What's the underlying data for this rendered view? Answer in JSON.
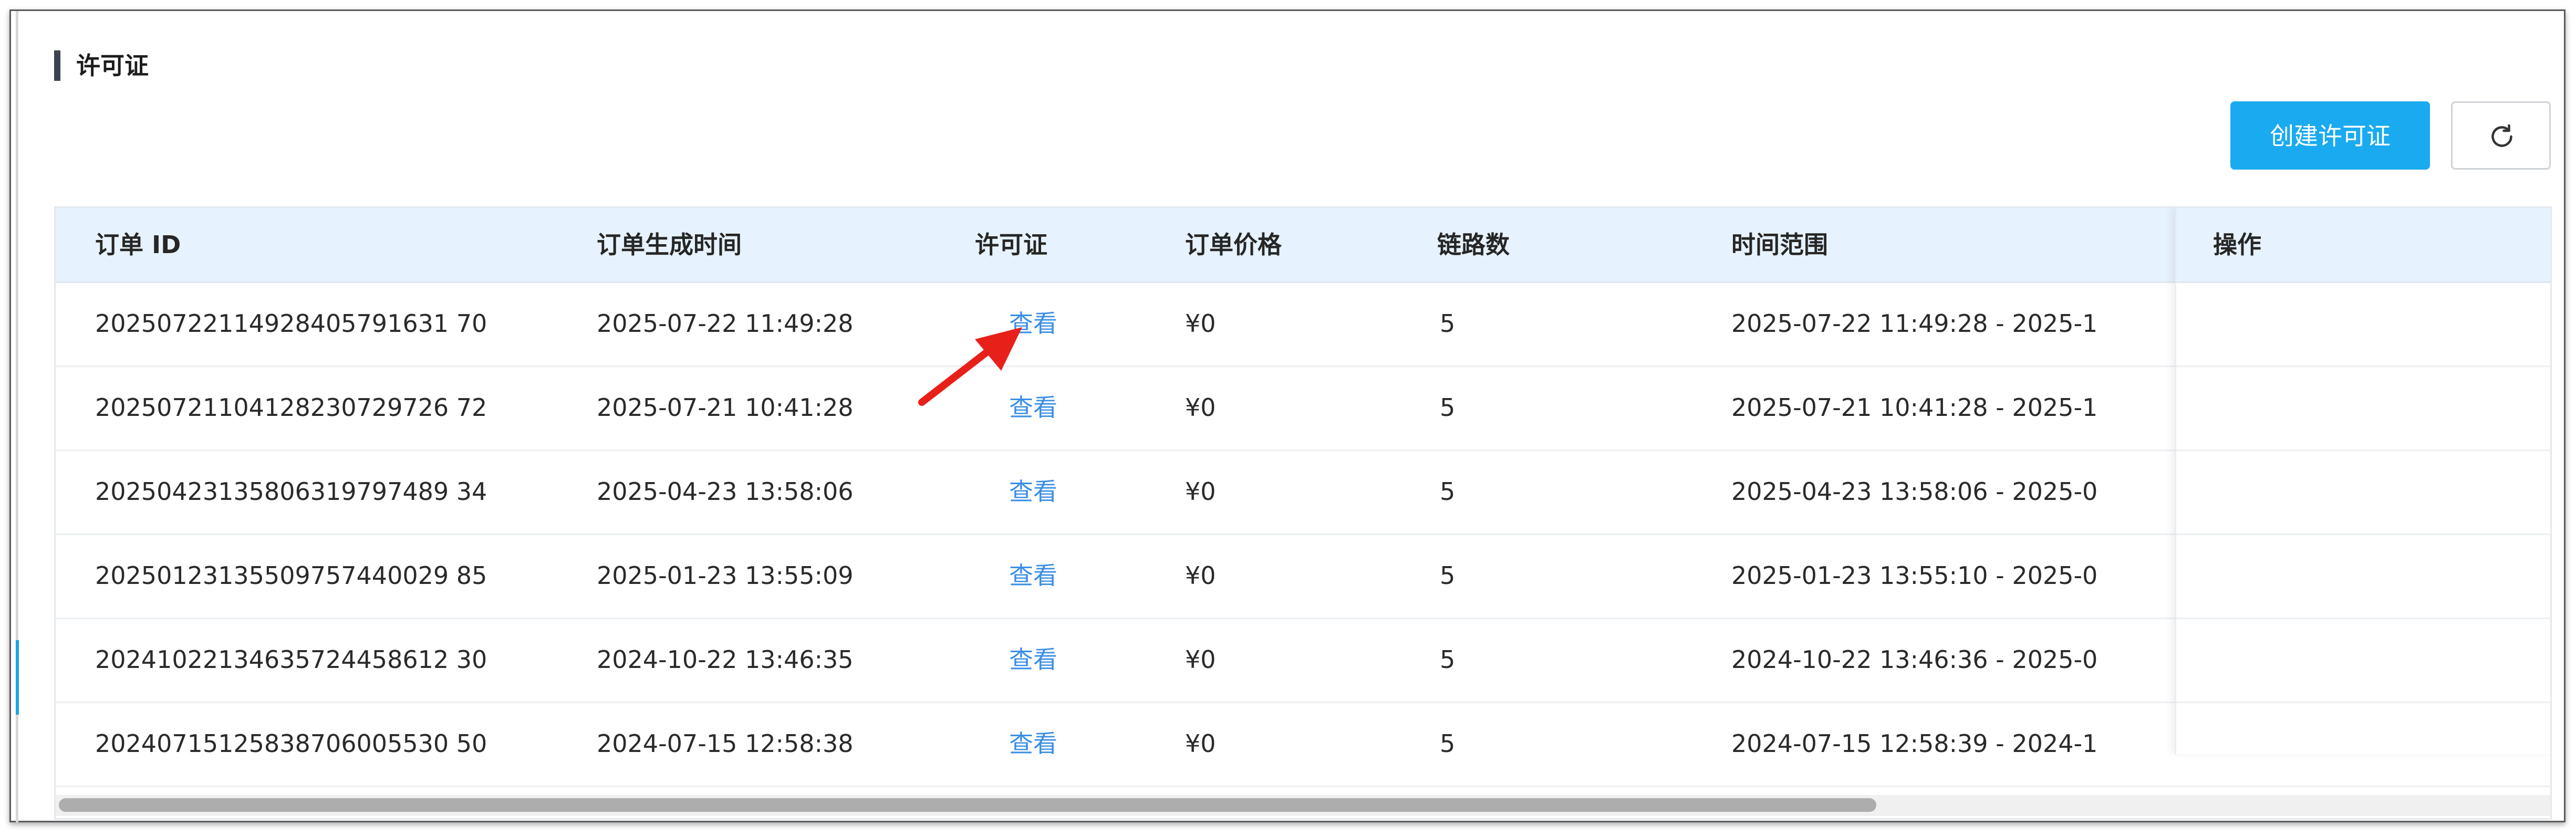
{
  "section": {
    "title": "许可证"
  },
  "toolbar": {
    "create_label": "创建许可证",
    "refresh_icon": "refresh-icon"
  },
  "table": {
    "headers": [
      "订单 ID",
      "订单生成时间",
      "许可证",
      "订单价格",
      "链路数",
      "时间范围",
      "操作"
    ],
    "rows": [
      {
        "order_id": "20250722114928405791631 70",
        "created": "2025-07-22 11:49:28",
        "license": "查看",
        "price": "¥0",
        "links": "5",
        "range": "2025-07-22 11:49:28 - 2025-1"
      },
      {
        "order_id": "20250721104128230729726 72",
        "created": "2025-07-21 10:41:28",
        "license": "查看",
        "price": "¥0",
        "links": "5",
        "range": "2025-07-21 10:41:28 - 2025-1"
      },
      {
        "order_id": "20250423135806319797489 34",
        "created": "2025-04-23 13:58:06",
        "license": "查看",
        "price": "¥0",
        "links": "5",
        "range": "2025-04-23 13:58:06 - 2025-0"
      },
      {
        "order_id": "20250123135509757440029 85",
        "created": "2025-01-23 13:55:09",
        "license": "查看",
        "price": "¥0",
        "links": "5",
        "range": "2025-01-23 13:55:10 - 2025-0"
      },
      {
        "order_id": "20241022134635724458612 30",
        "created": "2024-10-22 13:46:35",
        "license": "查看",
        "price": "¥0",
        "links": "5",
        "range": "2024-10-22 13:46:36 - 2025-0"
      },
      {
        "order_id": "20240715125838706005530 50",
        "created": "2024-07-15 12:58:38",
        "license": "查看",
        "price": "¥0",
        "links": "5",
        "range": "2024-07-15 12:58:39 - 2024-1"
      }
    ]
  },
  "colors": {
    "primary": "#1aaaf0",
    "link": "#3b8ee6",
    "header_bg": "#e6f2fd",
    "annotation": "#e8201a"
  }
}
